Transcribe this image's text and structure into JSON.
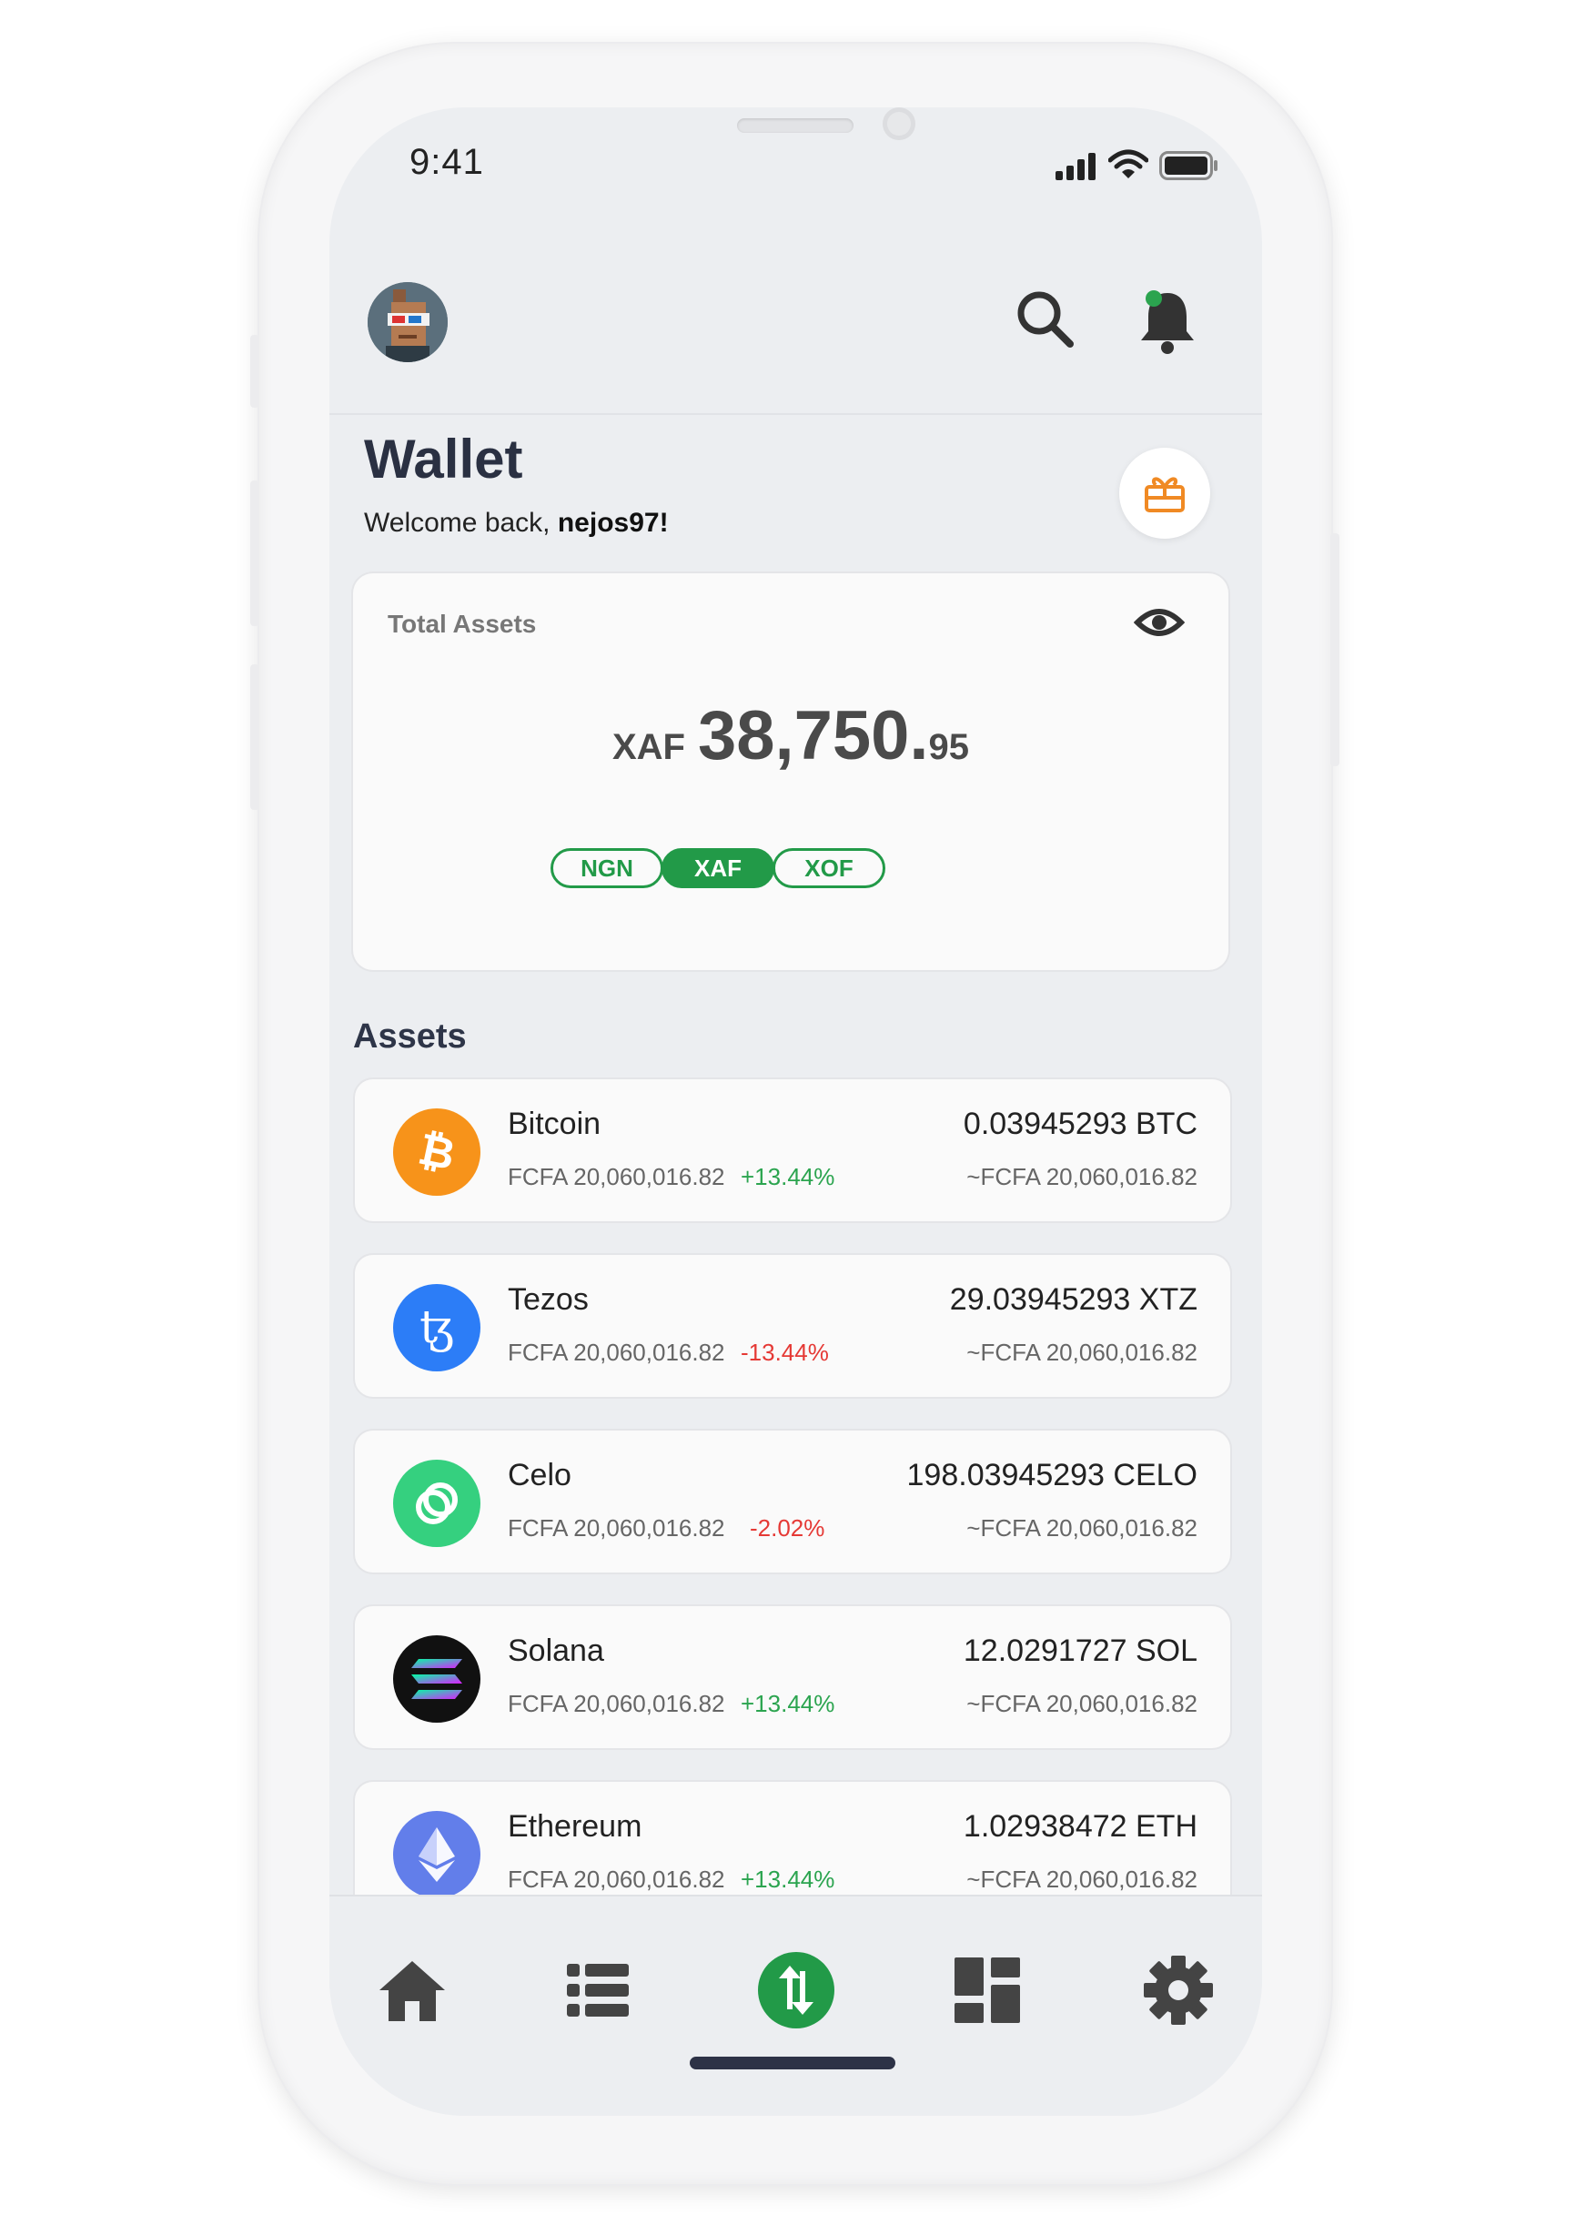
{
  "status_bar": {
    "time": "9:41"
  },
  "header": {
    "title": "Wallet",
    "welcome_prefix": "Welcome back, ",
    "username": "nejos97!"
  },
  "total_assets": {
    "label": "Total Assets",
    "currency": "XAF",
    "amount_main": "38,750.",
    "amount_cents": "95",
    "currencies": [
      {
        "code": "NGN",
        "active": false
      },
      {
        "code": "XAF",
        "active": true
      },
      {
        "code": "XOF",
        "active": false
      }
    ]
  },
  "assets_heading": "Assets",
  "assets": [
    {
      "name": "Bitcoin",
      "value": "FCFA 20,060,016.82",
      "change": "+13.44%",
      "amount": "0.03945293 BTC",
      "approx": "~FCFA 20,060,016.82",
      "color": "#f7931a",
      "icon": "bitcoin-icon"
    },
    {
      "name": "Tezos",
      "value": "FCFA 20,060,016.82",
      "change": "-13.44%",
      "amount": "29.03945293 XTZ",
      "approx": "~FCFA 20,060,016.82",
      "color": "#2c7df7",
      "icon": "tezos-icon"
    },
    {
      "name": "Celo",
      "value": "FCFA 20,060,016.82",
      "change": "-2.02%",
      "amount": "198.03945293 CELO",
      "approx": "~FCFA 20,060,016.82",
      "color": "#35d07f",
      "icon": "celo-icon"
    },
    {
      "name": "Solana",
      "value": "FCFA 20,060,016.82",
      "change": "+13.44%",
      "amount": "12.0291727 SOL",
      "approx": "~FCFA 20,060,016.82",
      "color": "#111111",
      "icon": "solana-icon"
    },
    {
      "name": "Ethereum",
      "value": "FCFA 20,060,016.82",
      "change": "+13.44%",
      "amount": "1.02938472 ETH",
      "approx": "~FCFA 20,060,016.82",
      "color": "#627eea",
      "icon": "ethereum-icon"
    }
  ],
  "bottom_nav": [
    "home-icon",
    "list-icon",
    "swap-icon",
    "dashboard-icon",
    "settings-icon"
  ],
  "colors": {
    "accent": "#229a48",
    "up": "#2ba44f",
    "down": "#e53935",
    "gift": "#f08a24"
  }
}
